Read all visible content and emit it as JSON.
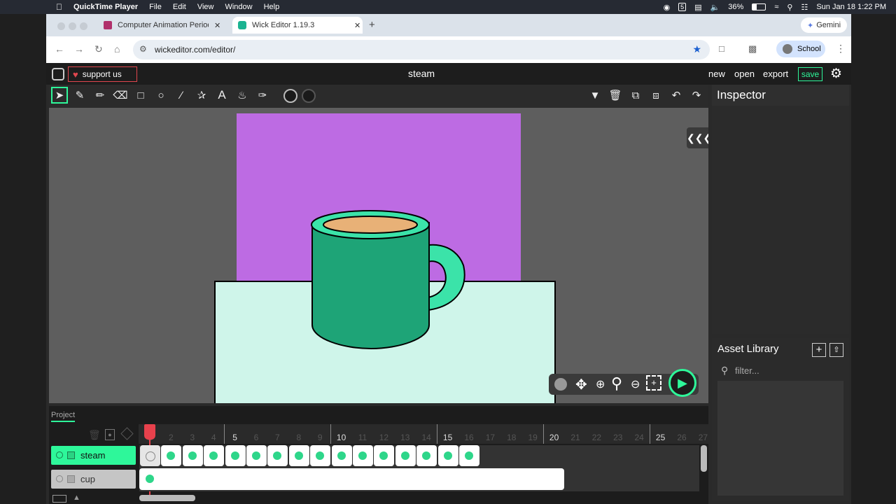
{
  "menubar": {
    "app": "QuickTime Player",
    "items": [
      "File",
      "Edit",
      "View",
      "Window",
      "Help"
    ],
    "battery": "36%",
    "datetime": "Sun Jan 18  1:22 PM"
  },
  "browser": {
    "tabs": [
      {
        "label": "Computer Animation Period 1",
        "active": false
      },
      {
        "label": "Wick Editor 1.19.3",
        "active": true
      }
    ],
    "url": "wickeditor.com/editor/",
    "gemini_label": "Gemini",
    "profile_label": "School"
  },
  "editor": {
    "support_label": "support us",
    "project_title": "steam",
    "menu": {
      "new": "new",
      "open": "open",
      "export": "export",
      "save": "save"
    },
    "inspector_title": "Inspector",
    "asset_library_title": "Asset Library",
    "filter_placeholder": "filter...",
    "timeline_tab": "Project",
    "layers": [
      {
        "name": "steam",
        "selected": true
      },
      {
        "name": "cup",
        "selected": false
      }
    ],
    "ruler": [
      "1",
      "2",
      "3",
      "4",
      "5",
      "6",
      "7",
      "8",
      "9",
      "10",
      "11",
      "12",
      "13",
      "14",
      "15",
      "16",
      "17",
      "18",
      "19",
      "20",
      "21",
      "22",
      "23",
      "24",
      "25",
      "26",
      "27"
    ],
    "steam_keyframes": 16,
    "colors": {
      "accent": "#2ef79a",
      "background_purple": "#bd6be3",
      "table": "#cff5ea",
      "mug_body": "#1ea477",
      "mug_rim": "#3be3a9",
      "coffee": "#e8b177",
      "playhead": "#e8414c"
    }
  }
}
